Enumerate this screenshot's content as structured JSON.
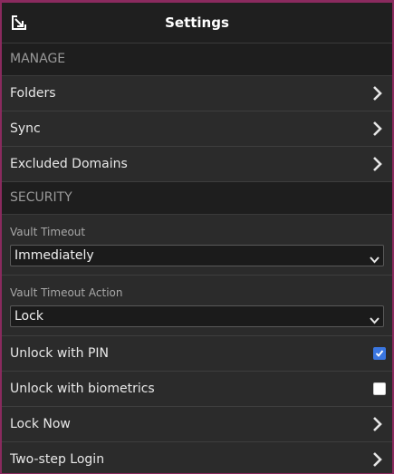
{
  "header": {
    "title": "Settings",
    "popout_icon": "popout-icon"
  },
  "manage": {
    "heading": "MANAGE",
    "items": [
      {
        "label": "Folders"
      },
      {
        "label": "Sync"
      },
      {
        "label": "Excluded Domains"
      }
    ]
  },
  "security": {
    "heading": "SECURITY",
    "vault_timeout": {
      "label": "Vault Timeout",
      "value": "Immediately"
    },
    "vault_timeout_action": {
      "label": "Vault Timeout Action",
      "value": "Lock"
    },
    "unlock_pin": {
      "label": "Unlock with PIN",
      "checked": true
    },
    "unlock_biometrics": {
      "label": "Unlock with biometrics",
      "checked": false
    },
    "items": [
      {
        "label": "Lock Now"
      },
      {
        "label": "Two-step Login"
      }
    ]
  },
  "colors": {
    "accent": "#3a76e0",
    "header_bg": "#1f1f1f",
    "row_bg": "#2b2b2b"
  }
}
